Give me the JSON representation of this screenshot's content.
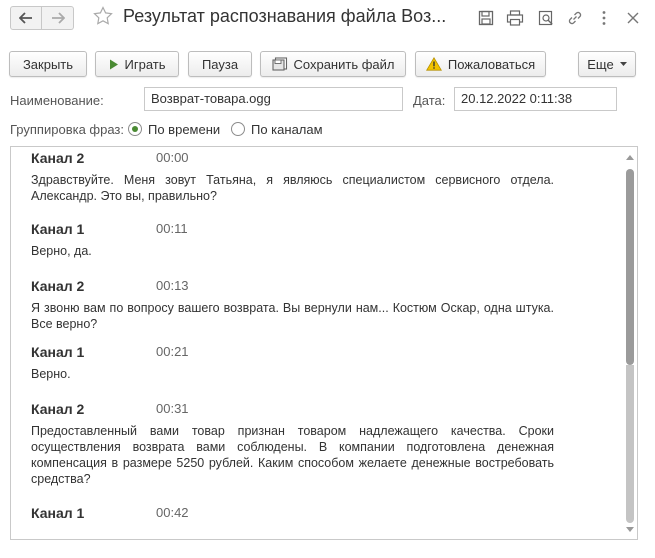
{
  "window": {
    "title": "Результат распознавания файла Воз..."
  },
  "toolbar": {
    "close_label": "Закрыть",
    "play_label": "Играть",
    "pause_label": "Пауза",
    "save_label": "Сохранить файл",
    "complain_label": "Пожаловаться",
    "more_label": "Еще"
  },
  "form": {
    "name_label": "Наименование:",
    "name_value": "Возврат-товара.ogg",
    "date_label": "Дата:",
    "date_value": "20.12.2022  0:11:38",
    "grouping_label": "Группировка фраз:",
    "grouping_options": [
      {
        "label": "По времени",
        "selected": true
      },
      {
        "label": "По каналам",
        "selected": false
      }
    ]
  },
  "transcript": [
    {
      "channel": "Канал 2",
      "time": "00:00",
      "text": "Здравствуйте. Меня зовут Татьяна, я являюсь специалистом сервисного отдела. Александр. Это вы, правильно?"
    },
    {
      "channel": "Канал 1",
      "time": "00:11",
      "text": "Верно, да."
    },
    {
      "channel": "Канал 2",
      "time": "00:13",
      "text": "Я звоню вам по вопросу вашего возврата. Вы вернули нам... Костюм Оскар, одна штука.   Все   верно?"
    },
    {
      "channel": "Канал 1",
      "time": "00:21",
      "text": "Верно."
    },
    {
      "channel": "Канал 2",
      "time": "00:31",
      "text": "Предоставленный вами товар признан товаром надлежащего качества. Сроки осуществления возврата вами соблюдены. В компании подготовлена денежная компенсация в размере 5250 рублей. Каким способом желаете денежные востребовать средства?"
    },
    {
      "channel": "Канал 1",
      "time": "00:42",
      "text": ""
    }
  ],
  "colors": {
    "accent_green": "#4a8a32",
    "warning_yellow": "#f2c200",
    "border": "#c9c9c9"
  }
}
